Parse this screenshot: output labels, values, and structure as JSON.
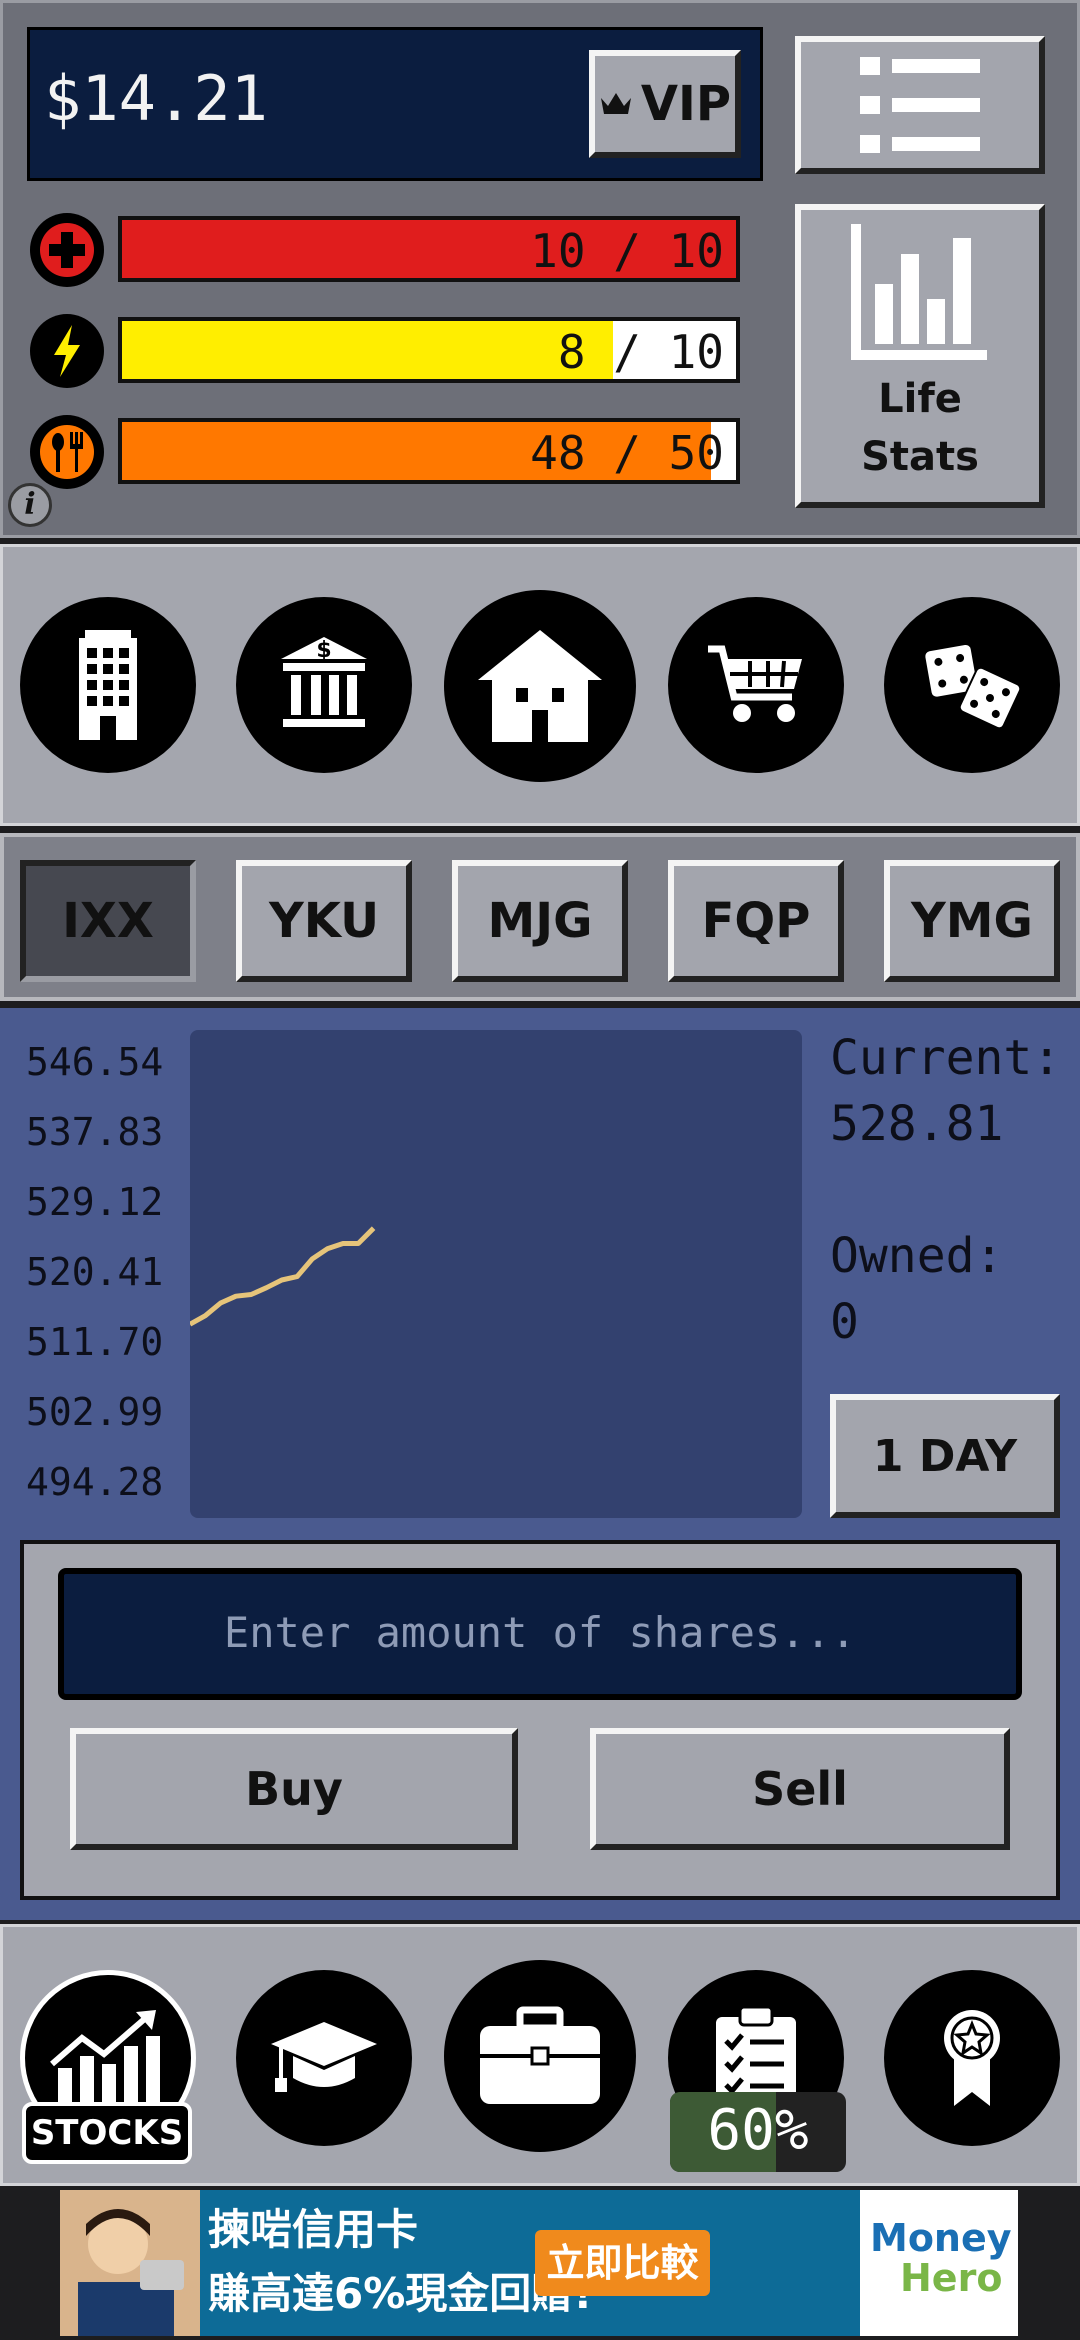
{
  "header": {
    "balance": "$14.21",
    "vip_label": "VIP",
    "life_stats_label_1": "Life",
    "life_stats_label_2": "Stats"
  },
  "stats": {
    "health": {
      "text": "10 / 10",
      "value": 10,
      "max": 10,
      "color": "#e01d1d",
      "icon": "health-cross-icon"
    },
    "energy": {
      "text": "8 / 10",
      "value": 8,
      "max": 10,
      "color": "#ffee00",
      "icon": "lightning-icon"
    },
    "food": {
      "text": "48 / 50",
      "value": 48,
      "max": 50,
      "color": "#ff7800",
      "icon": "fork-spoon-icon"
    }
  },
  "info_icon_label": "i",
  "nav_icons": [
    "office-building-icon",
    "bank-icon",
    "house-icon",
    "shopping-cart-icon",
    "dice-icon"
  ],
  "tickers": [
    {
      "label": "IXX",
      "selected": true
    },
    {
      "label": "YKU",
      "selected": false
    },
    {
      "label": "MJG",
      "selected": false
    },
    {
      "label": "FQP",
      "selected": false
    },
    {
      "label": "YMG",
      "selected": false
    }
  ],
  "stock": {
    "current_label": "Current:",
    "current_value": "528.81",
    "owned_label": "Owned:",
    "owned_value": "0",
    "range_button": "1 DAY",
    "shares_placeholder": "Enter amount of shares...",
    "buy_label": "Buy",
    "sell_label": "Sell"
  },
  "chart_data": {
    "type": "line",
    "title": "",
    "xlabel": "",
    "ylabel": "",
    "y_ticks": [
      "546.54",
      "537.83",
      "529.12",
      "520.41",
      "511.70",
      "502.99",
      "494.28"
    ],
    "ylim": [
      494.28,
      546.54
    ],
    "line_color": "#e6c47a",
    "background": "#33416f",
    "x_slots": 40,
    "series": [
      {
        "values": [
          514.5,
          515.5,
          517.0,
          517.8,
          518.0,
          518.8,
          519.7,
          520.1,
          522.2,
          523.4,
          524.0,
          524.0,
          525.8
        ]
      }
    ]
  },
  "bottom_nav": {
    "icons": [
      "stocks-icon",
      "graduation-cap-icon",
      "briefcase-icon",
      "clipboard-checklist-icon",
      "award-ribbon-icon"
    ],
    "stocks_label": "STOCKS",
    "progress_text": "60%",
    "progress_value": 0.6
  },
  "ad": {
    "line1": "揀啱信用卡",
    "line2": "賺高達6%現金回贈!",
    "cta": "立即比較",
    "brand1": "Money",
    "brand2": "Hero"
  }
}
